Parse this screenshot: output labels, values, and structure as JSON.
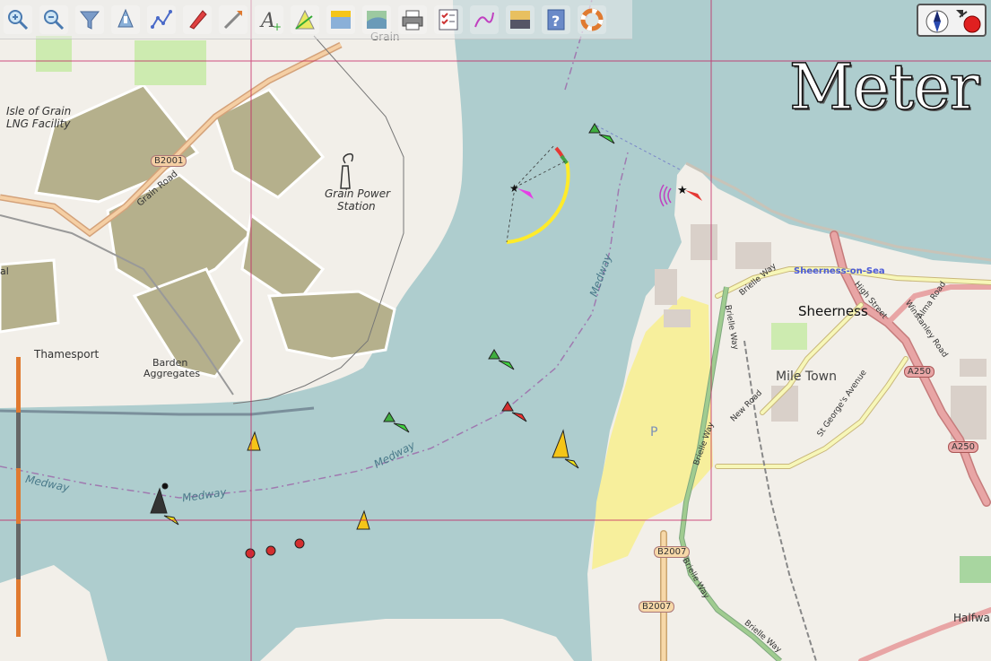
{
  "toolbar": {
    "buttons": [
      {
        "name": "zoom-in-button",
        "icon": "zoom-in-icon"
      },
      {
        "name": "zoom-out-button",
        "icon": "zoom-out-icon"
      },
      {
        "name": "filter-button",
        "icon": "funnel-icon"
      },
      {
        "name": "tide-button",
        "icon": "tide-icon"
      },
      {
        "name": "route-button",
        "icon": "route-icon"
      },
      {
        "name": "boat-button",
        "icon": "boat-icon"
      },
      {
        "name": "measure-button",
        "icon": "ruler-icon"
      },
      {
        "name": "text-button",
        "icon": "text-icon"
      },
      {
        "name": "light-sector-button",
        "icon": "light-sector-icon"
      },
      {
        "name": "layer-button",
        "icon": "layer-icon"
      },
      {
        "name": "chart-overlay-button",
        "icon": "chart-overlay-icon"
      },
      {
        "name": "print-button",
        "icon": "printer-icon"
      },
      {
        "name": "checklist-button",
        "icon": "checklist-icon"
      },
      {
        "name": "track-button",
        "icon": "track-icon"
      },
      {
        "name": "daylight-button",
        "icon": "daylight-icon"
      },
      {
        "name": "help-button",
        "icon": "help-icon"
      },
      {
        "name": "lifebuoy-button",
        "icon": "lifebuoy-icon"
      }
    ]
  },
  "compass": {
    "icon": "compass-icon",
    "status_icon": "recording-icon"
  },
  "unit_label": "Meter",
  "labels": {
    "grain": "Grain",
    "isle_of_grain_1": "Isle of Grain",
    "isle_of_grain_2": "LNG Facility",
    "b2001": "B2001",
    "grain_road": "Grain Road",
    "grain_power_1": "Grain Power",
    "grain_power_2": "Station",
    "thamesport": "Thamesport",
    "barden_1": "Barden",
    "barden_2": "Aggregates",
    "medway_1": "Medway",
    "medway_2": "Medway",
    "medway_3": "Medway",
    "medway_4": "Medway",
    "sheerness_on_sea": "Sheerness-on-Sea",
    "sheerness": "Sheerness",
    "mile_town": "Mile Town",
    "brielle_way_1": "Brielle Way",
    "brielle_way_2": "Brielle Way",
    "brielle_way_3": "Brielle Way",
    "brielle_way_4": "Brielle Way",
    "brielle_way_5": "Brielle Way",
    "high_street": "High Street",
    "alma_road": "Alma Road",
    "winstanley_road": "Winstanley Road",
    "new_road": "New Road",
    "st_georges": "St George's Avenue",
    "a250_1": "A250",
    "a250_2": "A250",
    "b2007_1": "B2007",
    "b2007_2": "B2007",
    "parking": "P",
    "halfway": "Halfwa",
    "left_edge": "al"
  },
  "colors": {
    "water": "#aecdce",
    "land": "#f2efe9",
    "industrial": "#b5b08c",
    "beach": "#f7ef9c",
    "primary_road": "#e8a5a5",
    "secondary_road": "#f7f7b8",
    "grid_line": "#c2185b"
  }
}
